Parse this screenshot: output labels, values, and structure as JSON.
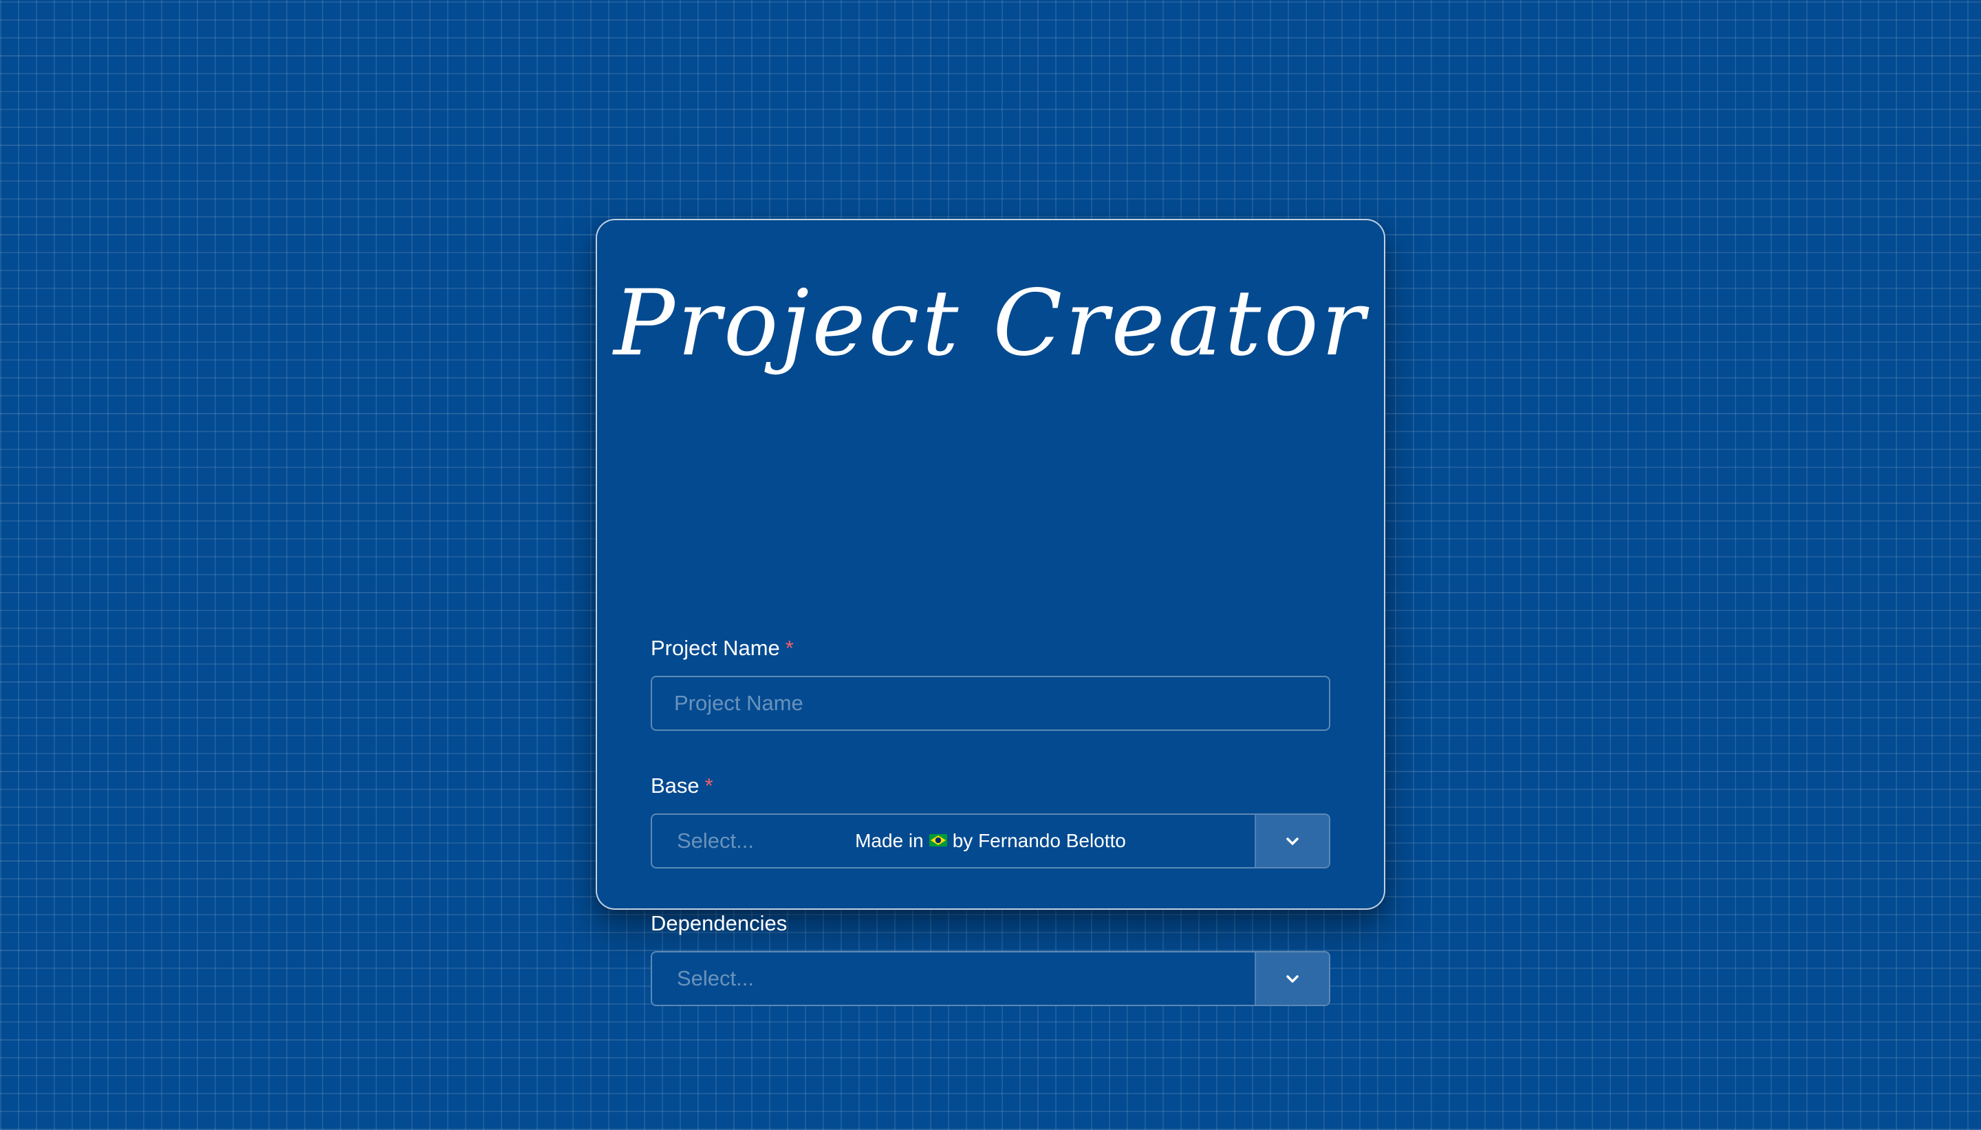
{
  "app": {
    "title": "Project Creator"
  },
  "form": {
    "project_name": {
      "label": "Project Name",
      "required_mark": "*",
      "placeholder": "Project Name",
      "value": ""
    },
    "base": {
      "label": "Base",
      "required_mark": "*",
      "placeholder": "Select..."
    },
    "dependencies": {
      "label": "Dependencies",
      "placeholder": "Select..."
    }
  },
  "footer": {
    "prefix": "Made in",
    "flag_icon": "brazil-flag-icon",
    "suffix": "by Fernando Belotto"
  },
  "colors": {
    "background": "#034b92",
    "card": "#044a90",
    "required": "#f25f6c",
    "dropdown_button": "#2f6aa8"
  }
}
